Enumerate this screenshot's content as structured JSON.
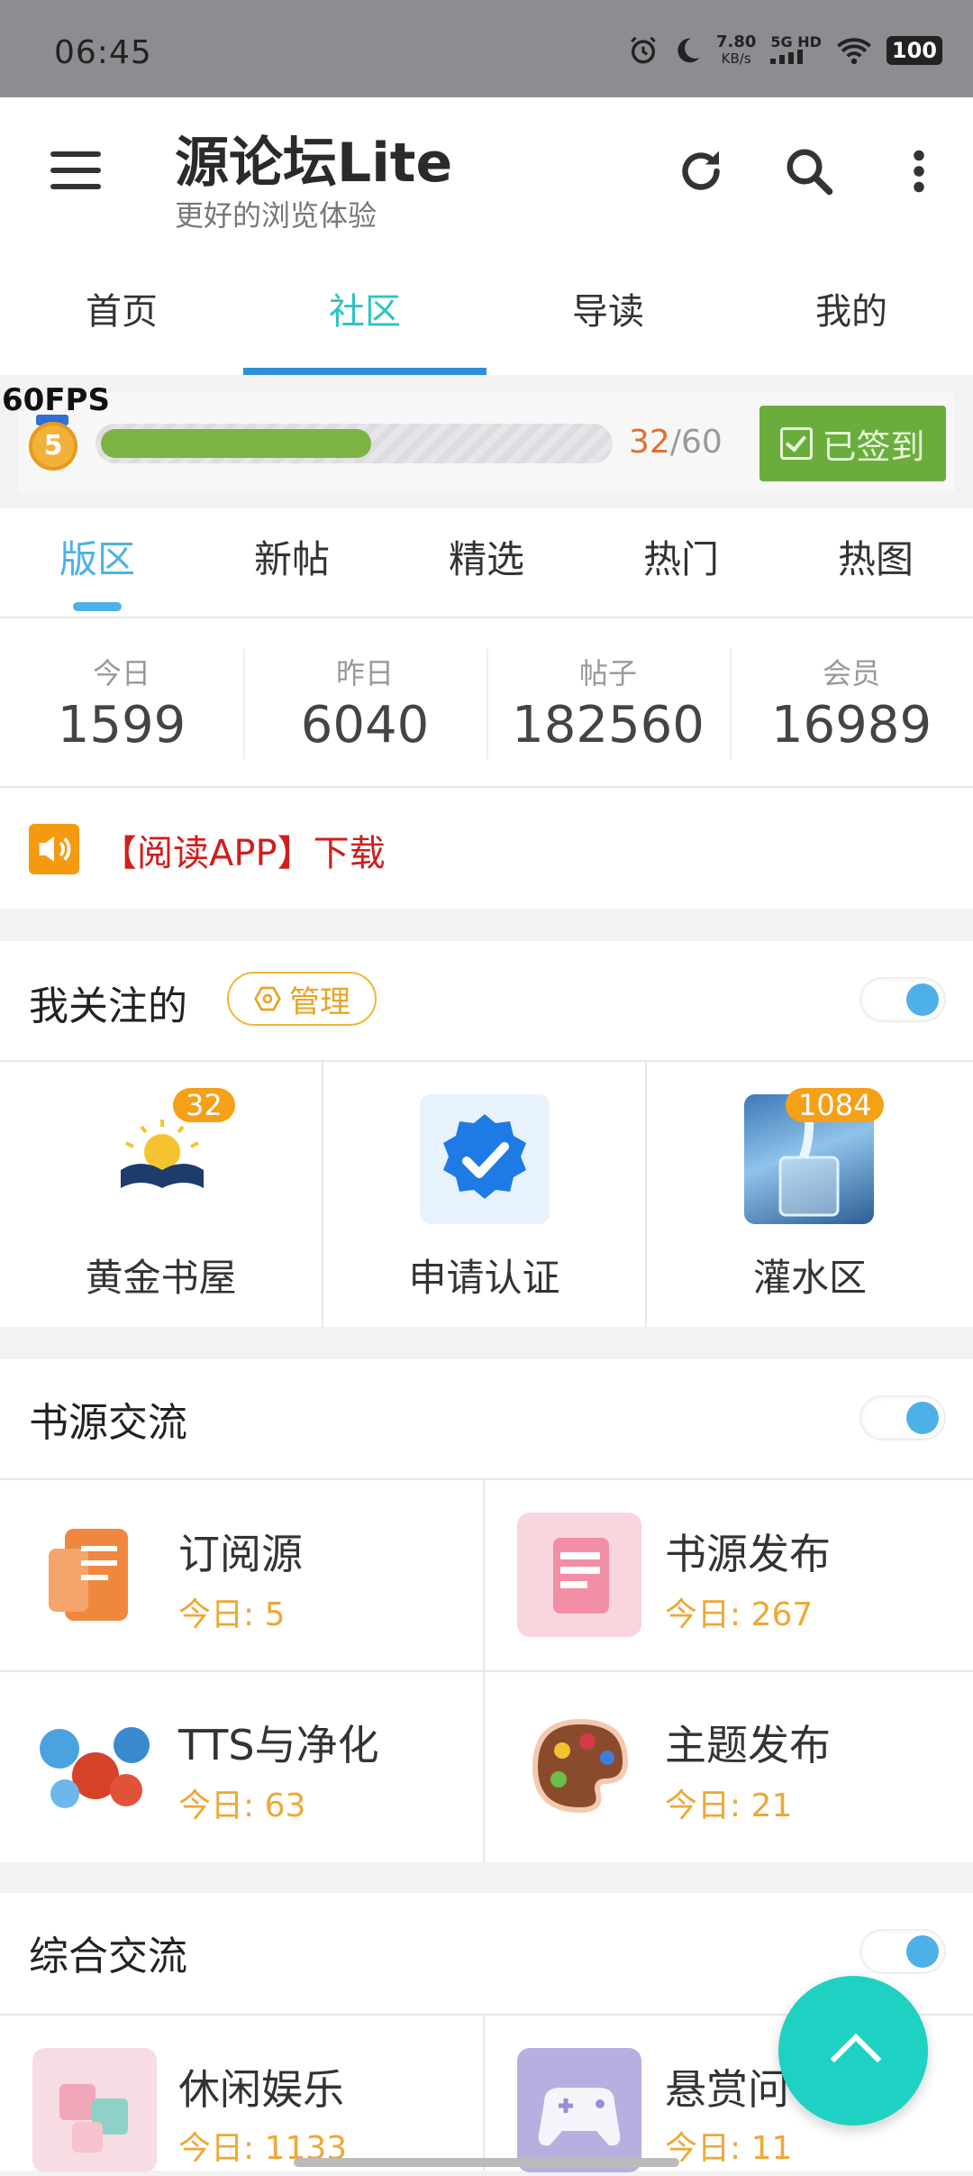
{
  "status_bar": {
    "time": "06:45",
    "net_rate_value": "7.80",
    "net_rate_unit": "KB/s",
    "signal": "5G HD",
    "battery": "100",
    "icons": [
      "alarm-icon",
      "moon-icon",
      "signal-icon",
      "wifi-icon",
      "battery-icon"
    ]
  },
  "app_bar": {
    "title": "源论坛Lite",
    "subtitle": "更好的浏览体验",
    "icons": [
      "menu-icon",
      "refresh-icon",
      "search-icon",
      "more-vert-icon"
    ]
  },
  "main_tabs": [
    {
      "label": "首页"
    },
    {
      "label": "社区",
      "active": true
    },
    {
      "label": "导读"
    },
    {
      "label": "我的"
    }
  ],
  "progress": {
    "fps": "60FPS",
    "level": "5",
    "current": "32",
    "max": "/60",
    "fraction": 0.533,
    "checkin_label": "已签到"
  },
  "sub_tabs": [
    {
      "label": "版区",
      "active": true
    },
    {
      "label": "新帖"
    },
    {
      "label": "精选"
    },
    {
      "label": "热门"
    },
    {
      "label": "热图"
    }
  ],
  "stats": [
    {
      "label": "今日",
      "value": "1599"
    },
    {
      "label": "昨日",
      "value": "6040"
    },
    {
      "label": "帖子",
      "value": "182560"
    },
    {
      "label": "会员",
      "value": "16989"
    }
  ],
  "notice": {
    "text": "【阅读APP】下载"
  },
  "followed": {
    "title": "我关注的",
    "manage_label": "管理",
    "items": [
      {
        "name": "黄金书屋",
        "badge": "32"
      },
      {
        "name": "申请认证",
        "badge": ""
      },
      {
        "name": "灌水区",
        "badge": "1084"
      }
    ]
  },
  "section_book_sources": {
    "title": "书源交流",
    "forums": [
      {
        "name": "订阅源",
        "today": "今日: 5"
      },
      {
        "name": "书源发布",
        "today": "今日: 267"
      },
      {
        "name": "TTS与净化",
        "today": "今日: 63"
      },
      {
        "name": "主题发布",
        "today": "今日: 21"
      }
    ]
  },
  "section_general": {
    "title": "综合交流",
    "forums": [
      {
        "name": "休闲娱乐",
        "today": "今日: 1133"
      },
      {
        "name": "悬赏问",
        "today": "今日: 11"
      }
    ]
  },
  "colors": {
    "accent_teal": "#2ec4c0",
    "tab_blue": "#4db1e8",
    "checkin_green": "#6aad3c",
    "today_orange": "#efa735",
    "notice_red": "#d11d1d",
    "fab": "#1fd1c2"
  }
}
